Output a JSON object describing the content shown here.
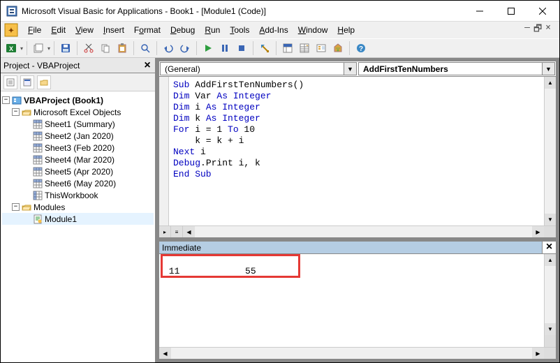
{
  "window": {
    "title": "Microsoft Visual Basic for Applications - Book1 - [Module1 (Code)]"
  },
  "menu": {
    "file": "File",
    "edit": "Edit",
    "view": "View",
    "insert": "Insert",
    "format": "Format",
    "debug": "Debug",
    "run": "Run",
    "tools": "Tools",
    "addins": "Add-Ins",
    "window": "Window",
    "help": "Help"
  },
  "project_pane": {
    "title": "Project - VBAProject",
    "root": "VBAProject (Book1)",
    "excel_objects_folder": "Microsoft Excel Objects",
    "sheets": [
      "Sheet1 (Summary)",
      "Sheet2 (Jan 2020)",
      "Sheet3 (Feb 2020)",
      "Sheet4 (Mar 2020)",
      "Sheet5 (Apr 2020)",
      "Sheet6 (May 2020)"
    ],
    "this_workbook": "ThisWorkbook",
    "modules_folder": "Modules",
    "module1": "Module1"
  },
  "code": {
    "object_combo": "(General)",
    "proc_combo": "AddFirstTenNumbers",
    "lines": {
      "l0a": "Sub",
      "l0b": " AddFirstTenNumbers()",
      "l1a": "Dim",
      "l1b": " Var ",
      "l1c": "As Integer",
      "l2a": "Dim",
      "l2b": " i ",
      "l2c": "As Integer",
      "l3a": "Dim",
      "l3b": " k ",
      "l3c": "As Integer",
      "l4a": "For",
      "l4b": " i = 1 ",
      "l4c": "To",
      "l4d": " 10",
      "l5": "    k = k + i",
      "l6a": "Next",
      "l6b": " i",
      "l7a": "Debug",
      "l7b": ".Print i, k",
      "l8": "End Sub"
    }
  },
  "immediate": {
    "title": "Immediate",
    "output": " 11            55"
  }
}
